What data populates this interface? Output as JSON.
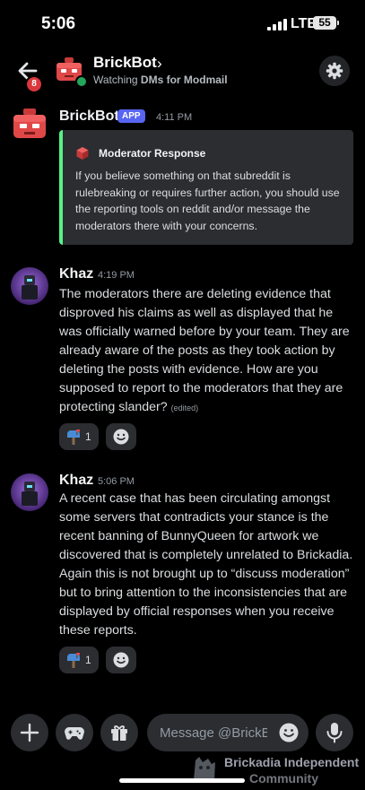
{
  "status_bar": {
    "time": "5:06",
    "network": "LTE",
    "battery": "55"
  },
  "header": {
    "unread_badge": "8",
    "name": "BrickBot",
    "chevron": "›",
    "subtitle_prefix": "Watching",
    "subtitle_bold": "DMs for Modmail"
  },
  "messages": [
    {
      "author": "BrickBot",
      "tag": "APP",
      "time": "4:11 PM",
      "embed": {
        "title": "Moderator Response",
        "description": "If you believe something on that subreddit is rulebreaking or requires further action, you should use the reporting tools on reddit and/or message the moderators there with your concerns.",
        "accent_color": "#57f287"
      }
    },
    {
      "author": "Khaz",
      "time": "4:19 PM",
      "text": "The moderators there are deleting evidence that disproved his claims as well as displayed that he was officially warned before by your team. They are already aware of the posts as they took action by deleting the posts with evidence. How are you supposed to report to the moderators that they are protecting slander?",
      "edited": "(edited)",
      "reaction": {
        "emoji": "mailbox-icon",
        "count": "1"
      }
    },
    {
      "author": "Khaz",
      "time": "5:06 PM",
      "text": "A recent case that has been circulating amongst some servers that contradicts your stance is the recent banning of BunnyQueen for artwork we discovered that is completely unrelated to Brickadia. Again this is not brought up to “discuss moderation” but to bring attention to the inconsistencies that are displayed by official responses when you receive these reports.",
      "reaction": {
        "emoji": "mailbox-icon",
        "count": "1"
      }
    }
  ],
  "composer": {
    "placeholder": "Message @BrickB…"
  },
  "watermark": {
    "line1": "Brickadia Independent",
    "line2": "Community"
  },
  "colors": {
    "background": "#000000",
    "brand": "#5865f2",
    "online": "#23a55a",
    "badge": "#da373c"
  }
}
